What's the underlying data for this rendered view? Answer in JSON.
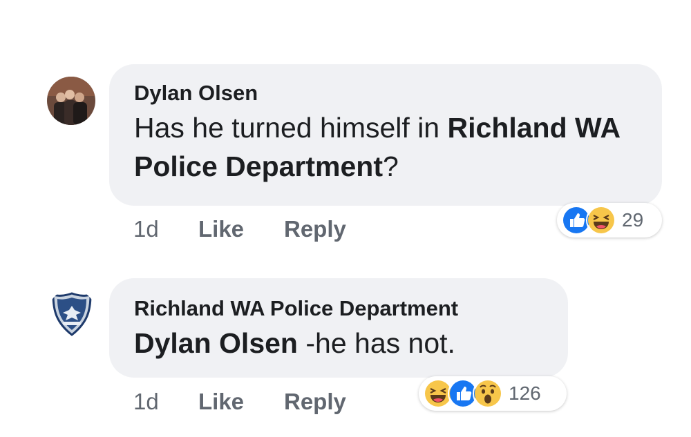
{
  "comments": [
    {
      "author": "Dylan Olsen",
      "avatar": "group-photo-avatar",
      "text_plain": "Has he turned himself in ",
      "text_tag": "Richland WA Police Department",
      "text_end": "?",
      "time": "1d",
      "like_label": "Like",
      "reply_label": "Reply",
      "reactions": [
        "like-icon",
        "haha-icon"
      ],
      "reaction_count": "29"
    },
    {
      "author": "Richland WA Police Department",
      "avatar": "police-badge-avatar",
      "text_tag": "Dylan Olsen",
      "text_plain": " -he has not.",
      "time": "1d",
      "like_label": "Like",
      "reply_label": "Reply",
      "reactions": [
        "haha-icon",
        "like-icon",
        "wow-icon"
      ],
      "reaction_count": "126"
    }
  ],
  "colors": {
    "bubble": "#f0f1f4",
    "text": "#1c1e21",
    "meta": "#616770",
    "like_blue": "#1877f2",
    "emoji_yellow": "#f7c64a"
  }
}
